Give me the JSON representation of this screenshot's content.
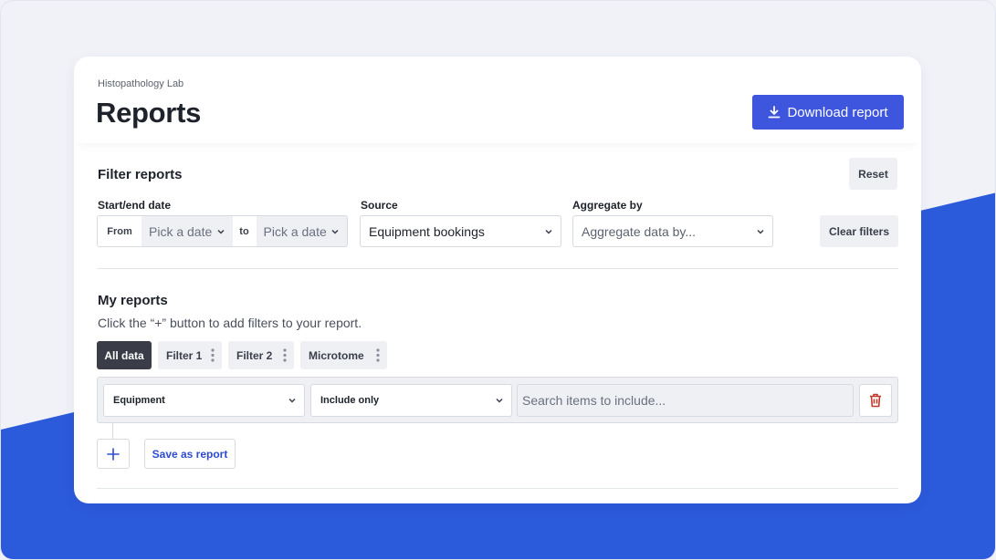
{
  "colors": {
    "accent": "#3e55dd",
    "background_blue": "#2b5ada",
    "danger": "#c0392b"
  },
  "header": {
    "eyebrow": "Histopathology Lab",
    "title": "Reports",
    "download_label": "Download report",
    "download_icon": "download-icon"
  },
  "filters": {
    "title": "Filter reports",
    "reset_label": "Reset",
    "clear_label": "Clear filters",
    "date": {
      "label": "Start/end date",
      "from_label": "From",
      "from_placeholder": "Pick a date",
      "to_label": "to",
      "to_placeholder": "Pick a date"
    },
    "source": {
      "label": "Source",
      "value": "Equipment bookings"
    },
    "aggregate": {
      "label": "Aggregate by",
      "placeholder": "Aggregate data by..."
    }
  },
  "my_reports": {
    "title": "My reports",
    "hint": "Click the “+” button to add filters to your report.",
    "tabs": [
      {
        "label": "All data",
        "active": true
      },
      {
        "label": "Filter 1",
        "active": false
      },
      {
        "label": "Filter 2",
        "active": false
      },
      {
        "label": "Microtome",
        "active": false
      }
    ],
    "filter_row": {
      "field": "Equipment",
      "operator": "Include only",
      "search_placeholder": "Search items to include...",
      "delete_icon": "trash-icon"
    },
    "add_icon": "plus-icon",
    "save_label": "Save as report"
  }
}
